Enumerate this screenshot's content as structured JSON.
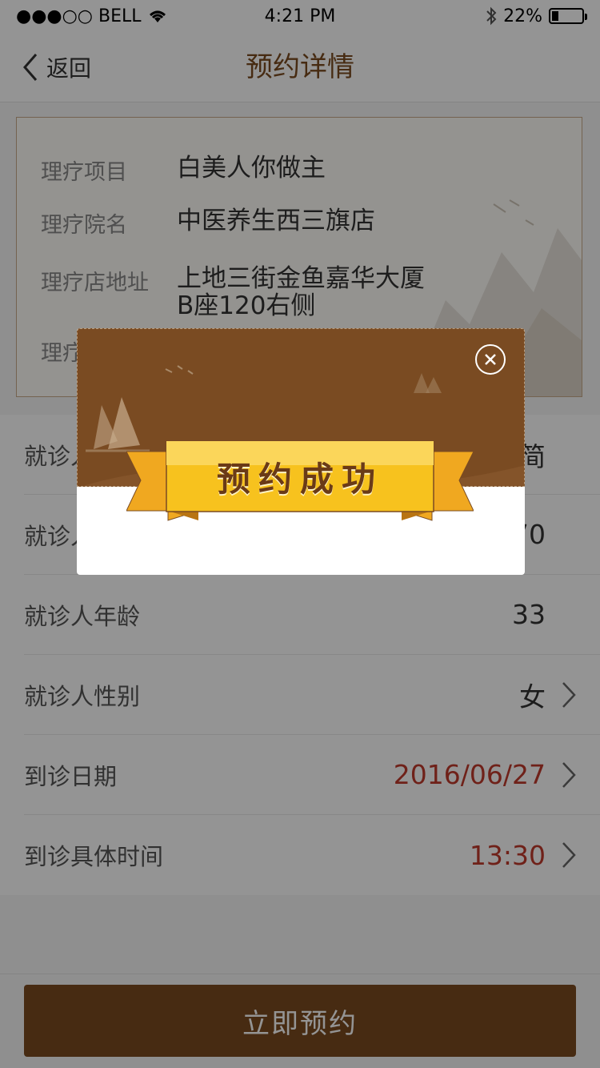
{
  "status_bar": {
    "carrier": "●●●○○ BELL",
    "time": "4:21 PM",
    "battery_text": "22%",
    "battery_level": 0.22
  },
  "nav": {
    "back_label": "返回",
    "title": "预约详情"
  },
  "info": {
    "rows": [
      {
        "label": "理疗项目",
        "value": "白美人你做主"
      },
      {
        "label": "理疗院名",
        "value": "中医养生西三旗店"
      },
      {
        "label": "理疗店地址",
        "value_line1": "上地三街金鱼嘉华大厦",
        "value_line2": "B座120右侧"
      },
      {
        "label": "理疗"
      }
    ]
  },
  "form": {
    "rows": [
      {
        "label": "就诊人",
        "value": "简"
      },
      {
        "label": "就诊人",
        "value": "70"
      },
      {
        "label": "就诊人年龄",
        "value": "33"
      },
      {
        "label": "就诊人性别",
        "value": "女"
      },
      {
        "label": "到诊日期",
        "value": "2016/06/27"
      },
      {
        "label": "到诊具体时间",
        "value": "13:30"
      }
    ]
  },
  "submit_label": "立即预约",
  "modal": {
    "title": "预约成功",
    "close_icon": "close-circle-icon"
  },
  "colors": {
    "brand_brown": "#7b4a1f",
    "title_brown": "#7a4b1f",
    "highlight_red": "#c0392b",
    "ribbon_gold": "#f5c219"
  }
}
